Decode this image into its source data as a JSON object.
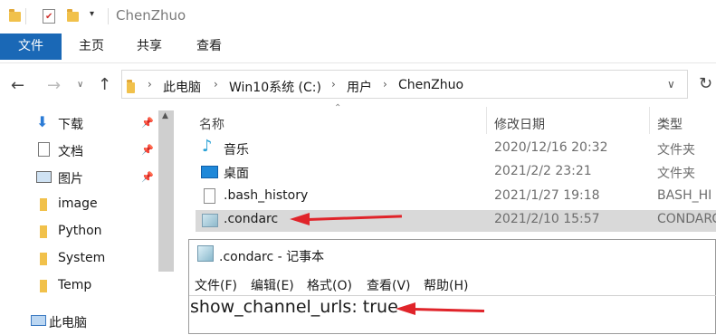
{
  "window": {
    "title": "ChenZhuo"
  },
  "ribbon": {
    "tabs": [
      "文件",
      "主页",
      "共享",
      "查看"
    ]
  },
  "address": {
    "crumbs": [
      "此电脑",
      "Win10系统 (C:)",
      "用户",
      "ChenZhuo"
    ]
  },
  "nav": {
    "items": [
      "下载",
      "文档",
      "图片",
      "image",
      "Python",
      "System",
      "Temp",
      "此电脑"
    ]
  },
  "columns": {
    "name": "名称",
    "date": "修改日期",
    "type": "类型"
  },
  "files": [
    {
      "name": "音乐",
      "date": "2020/12/16 20:32",
      "type": "文件夹",
      "icon": "music-icon"
    },
    {
      "name": "桌面",
      "date": "2021/2/2 23:21",
      "type": "文件夹",
      "icon": "desktop-icon"
    },
    {
      "name": ".bash_history",
      "date": "2021/1/27 19:18",
      "type": "BASH_HI",
      "icon": "file-icon"
    },
    {
      "name": ".condarc",
      "date": "2021/2/10 15:57",
      "type": "CONDARC",
      "icon": "condarc-file-icon"
    }
  ],
  "notepad": {
    "title": ".condarc - 记事本",
    "menus": [
      "文件(F)",
      "编辑(E)",
      "格式(O)",
      "查看(V)",
      "帮助(H)"
    ],
    "content": "show_channel_urls: true"
  },
  "colors": {
    "accent": "#1a68b6",
    "selection": "#d9d9d9",
    "annotation": "#e0242a"
  }
}
